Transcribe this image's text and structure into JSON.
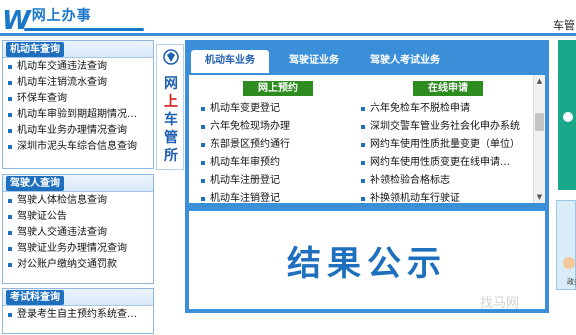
{
  "header": {
    "brand_letter": "W",
    "brand_text": "网上办事",
    "top_right": "车管"
  },
  "sidebar": {
    "vehicle": {
      "title": "机动车查询",
      "items": [
        "机动车交通违法查询",
        "机动车注销流水查询",
        "环保车查询",
        "机动车审验到期超期情况…",
        "机动车业务办理情况查询",
        "深圳市泥头车综合信息查询"
      ]
    },
    "driver": {
      "title": "驾驶人查询",
      "items": [
        "驾驶人体检信息查询",
        "驾驶证公告",
        "驾驶人交通违法查询",
        "驾驶证业务办理情况查询",
        "对公账户缴纳交通罚款"
      ]
    },
    "exam": {
      "title": "考试科查询",
      "items": [
        "登录考生自主预约系统查…"
      ]
    }
  },
  "vertical_title": {
    "chars": [
      "网",
      "上",
      "车",
      "管",
      "所"
    ]
  },
  "main": {
    "tabs": [
      "机动车业务",
      "驾驶证业务",
      "驾驶人考试业务"
    ],
    "online_booking": {
      "title": "网上预约",
      "items": [
        "机动车变更登记",
        "六年免检现场办理",
        "东部景区预约通行",
        "机动车年审预约",
        "机动车注册登记",
        "机动车注销登记"
      ]
    },
    "online_apply": {
      "title": "在线申请",
      "items": [
        "六年免检车不脱检申请",
        "深圳交警车管业务社会化申办系统",
        "网约车使用性质批量变更（单位）",
        "网约车使用性质变更在线申请…",
        "补领检验合格标志",
        "补换领机动车行驶证"
      ]
    },
    "results_label": "结果公示"
  },
  "right_edge": {
    "label": "政务"
  },
  "watermark": "找马网"
}
